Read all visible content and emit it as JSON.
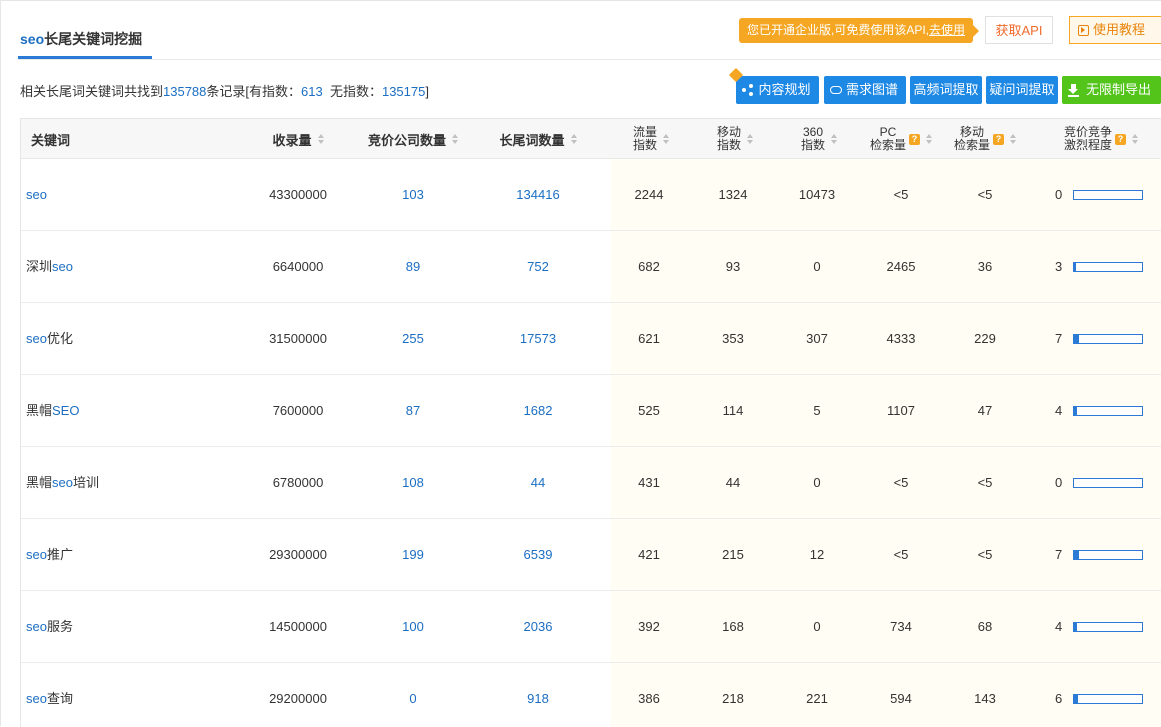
{
  "header": {
    "tab_title_kw": "seo",
    "tab_title_rest": "长尾关键词挖掘",
    "notice_text": "您已开通企业版,可免费使用该API,",
    "notice_link": "去使用",
    "api_button": "获取API",
    "tutorial_button": "使用教程"
  },
  "summary": {
    "prefix": "相关长尾词关键词共找到",
    "total": "135788",
    "middle": "条记录[有指数：",
    "with_index": "613",
    "no_index_label": "  无指数：",
    "no_index": "135175",
    "suffix": "]"
  },
  "actions": {
    "content_plan": "内容规划",
    "demand_graph": "需求图谱",
    "high_freq": "高频词提取",
    "question": "疑问词提取",
    "export": "无限制导出"
  },
  "table": {
    "headers": {
      "keyword": "关键词",
      "indexed": "收录量",
      "bid_companies": "竞价公司数量",
      "longtail": "长尾词数量",
      "traffic_1": "流量",
      "traffic_2": "指数",
      "mobile_1": "移动",
      "mobile_2": "指数",
      "s360_1": "360",
      "s360_2": "指数",
      "pc_1": "PC",
      "pc_2": "检索量",
      "msearch_1": "移动",
      "msearch_2": "检索量",
      "comp_1": "竞价竞争",
      "comp_2": "激烈程度",
      "help_mark": "?"
    },
    "rows": [
      {
        "kw_pre": "",
        "kw_hi": "seo",
        "kw_post": "",
        "indexed": "43300000",
        "bid": "103",
        "longtail": "134416",
        "traffic": "2244",
        "mobile": "1324",
        "s360": "10473",
        "pc": "<5",
        "msearch": "<5",
        "comp": "0"
      },
      {
        "kw_pre": "深圳",
        "kw_hi": "seo",
        "kw_post": "",
        "indexed": "6640000",
        "bid": "89",
        "longtail": "752",
        "traffic": "682",
        "mobile": "93",
        "s360": "0",
        "pc": "2465",
        "msearch": "36",
        "comp": "3"
      },
      {
        "kw_pre": "",
        "kw_hi": "seo",
        "kw_post": "优化",
        "indexed": "31500000",
        "bid": "255",
        "longtail": "17573",
        "traffic": "621",
        "mobile": "353",
        "s360": "307",
        "pc": "4333",
        "msearch": "229",
        "comp": "7"
      },
      {
        "kw_pre": "黑帽",
        "kw_hi": "SEO",
        "kw_post": "",
        "indexed": "7600000",
        "bid": "87",
        "longtail": "1682",
        "traffic": "525",
        "mobile": "114",
        "s360": "5",
        "pc": "1107",
        "msearch": "47",
        "comp": "4"
      },
      {
        "kw_pre": "黑帽",
        "kw_hi": "seo",
        "kw_post": "培训",
        "indexed": "6780000",
        "bid": "108",
        "longtail": "44",
        "traffic": "431",
        "mobile": "44",
        "s360": "0",
        "pc": "<5",
        "msearch": "<5",
        "comp": "0"
      },
      {
        "kw_pre": "",
        "kw_hi": "seo",
        "kw_post": "推广",
        "indexed": "29300000",
        "bid": "199",
        "longtail": "6539",
        "traffic": "421",
        "mobile": "215",
        "s360": "12",
        "pc": "<5",
        "msearch": "<5",
        "comp": "7"
      },
      {
        "kw_pre": "",
        "kw_hi": "seo",
        "kw_post": "服务",
        "indexed": "14500000",
        "bid": "100",
        "longtail": "2036",
        "traffic": "392",
        "mobile": "168",
        "s360": "0",
        "pc": "734",
        "msearch": "68",
        "comp": "4"
      },
      {
        "kw_pre": "",
        "kw_hi": "seo",
        "kw_post": "查询",
        "indexed": "29200000",
        "bid": "0",
        "longtail": "918",
        "traffic": "386",
        "mobile": "218",
        "s360": "221",
        "pc": "594",
        "msearch": "143",
        "comp": "6"
      }
    ]
  },
  "icons": {
    "content_plan": "share-icon",
    "demand_graph": "cloud-icon",
    "export": "download-icon",
    "tutorial": "play-icon",
    "vip": "diamond-icon"
  },
  "colors": {
    "link": "#1b6ec2",
    "action_blue": "#1e88e5",
    "action_green": "#52c41a",
    "notice": "#f5a623",
    "api_text": "#f06a2b"
  }
}
